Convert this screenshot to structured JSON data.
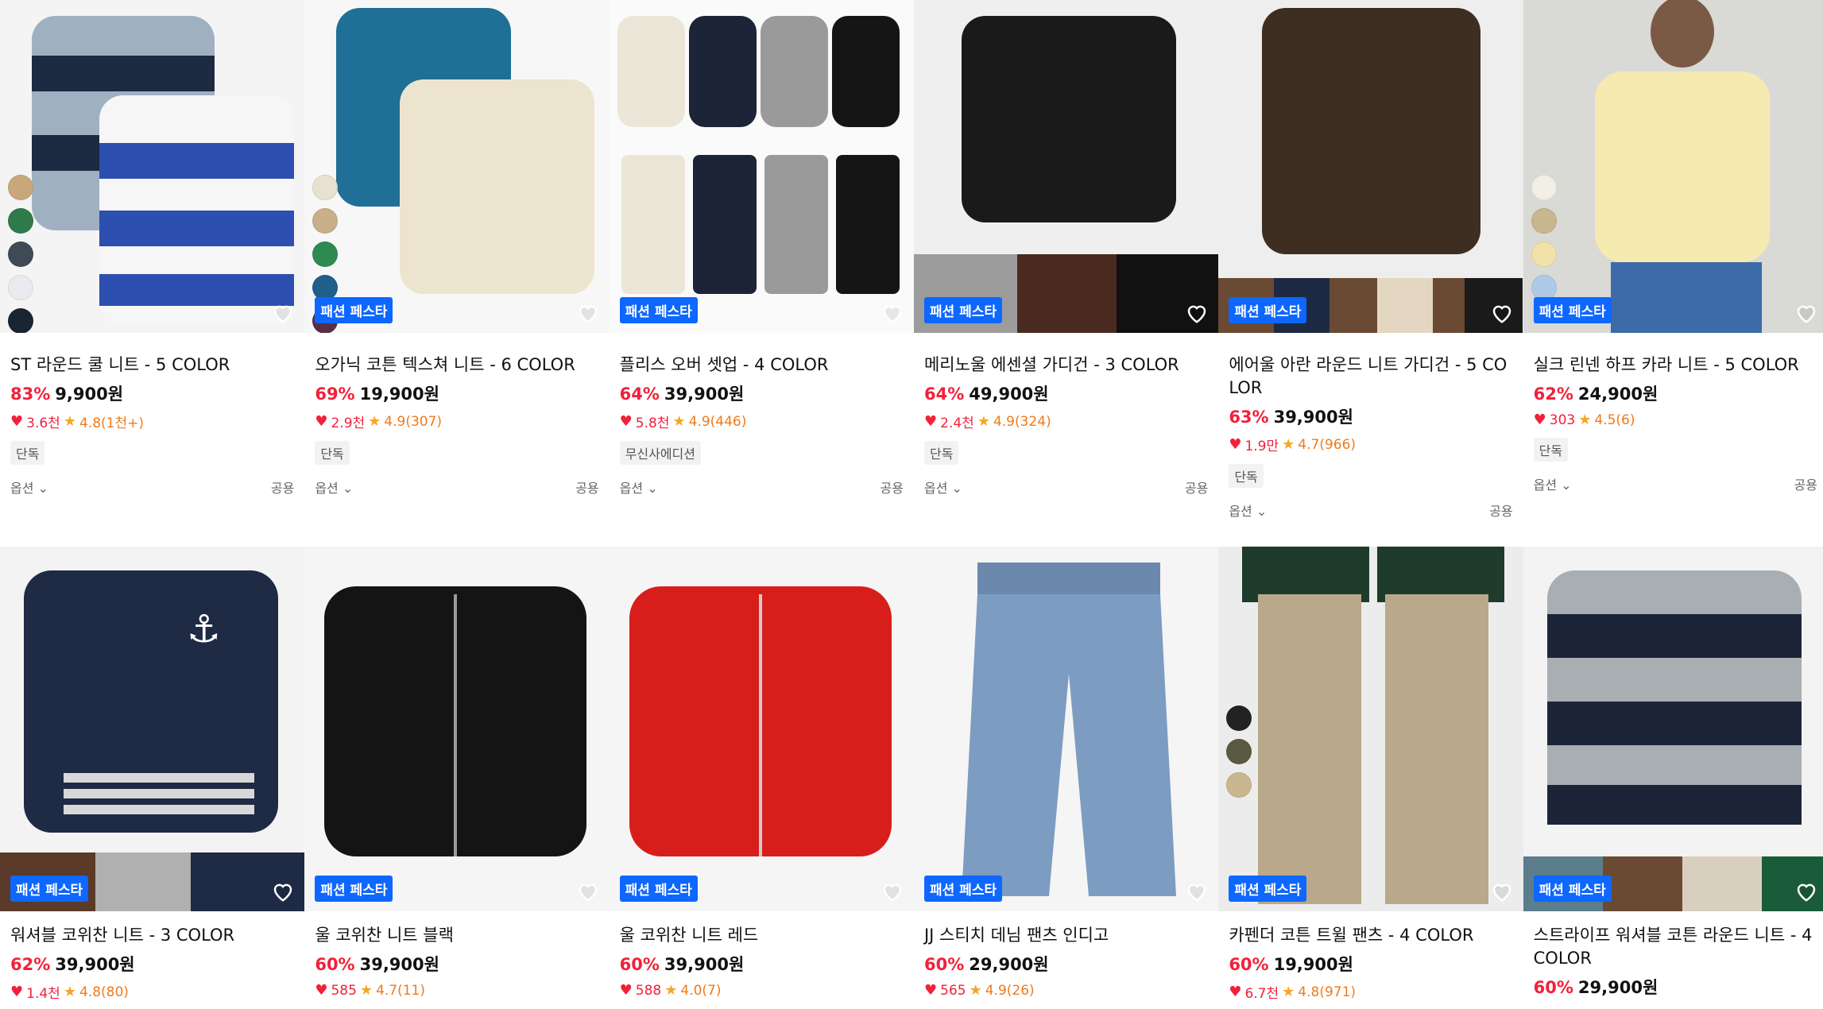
{
  "badge_label": "패션 페스타",
  "option_label": "옵션",
  "gender_label": "공용",
  "products": [
    {
      "title": "ST 라운드 쿨 니트 - 5 COLOR",
      "discount": "83%",
      "price": "9,900원",
      "likes": "3.6천",
      "rating": "4.8(1천+)",
      "tag": "단독",
      "festa": false,
      "swatches": [
        "#c9a77a",
        "#2f7a4a",
        "#3f4a55",
        "#eaeaf0",
        "#1a2533"
      ]
    },
    {
      "title": "오가닉 코튼 텍스쳐 니트 - 6 COLOR",
      "discount": "69%",
      "price": "19,900원",
      "likes": "2.9천",
      "rating": "4.9(307)",
      "tag": "단독",
      "festa": true,
      "swatches": [
        "#e9e1cf",
        "#c7b08a",
        "#2e8a50",
        "#1f5f8a",
        "#5a2f45"
      ]
    },
    {
      "title": "플리스 오버 셋업 - 4 COLOR",
      "discount": "64%",
      "price": "39,900원",
      "likes": "5.8천",
      "rating": "4.9(446)",
      "tag": "무신사에디션",
      "festa": true,
      "swatches": []
    },
    {
      "title": "메리노울 에센셜 가디건 - 3 COLOR",
      "discount": "64%",
      "price": "49,900원",
      "likes": "2.4천",
      "rating": "4.9(324)",
      "tag": "단독",
      "festa": true,
      "swatches": []
    },
    {
      "title": "에어울 아란 라운드 니트 가디건 - 5 COLOR",
      "discount": "63%",
      "price": "39,900원",
      "likes": "1.9만",
      "rating": "4.7(966)",
      "tag": "단독",
      "festa": true,
      "swatches": []
    },
    {
      "title": "실크 린넨 하프 카라 니트 - 5 COLOR",
      "discount": "62%",
      "price": "24,900원",
      "likes": "303",
      "rating": "4.5(6)",
      "tag": "단독",
      "festa": true,
      "swatches": [
        "#f2efe7",
        "#c8b68e",
        "#f0e2a8",
        "#aecae6"
      ]
    },
    {
      "title": "워셔블 코위찬 니트 - 3 COLOR",
      "discount": "62%",
      "price": "39,900원",
      "likes": "1.4천",
      "rating": "4.8(80)",
      "tag": "",
      "festa": true,
      "swatches": []
    },
    {
      "title": "울 코위찬 니트 블랙",
      "discount": "60%",
      "price": "39,900원",
      "likes": "585",
      "rating": "4.7(11)",
      "tag": "",
      "festa": true,
      "swatches": []
    },
    {
      "title": "울 코위찬 니트 레드",
      "discount": "60%",
      "price": "39,900원",
      "likes": "588",
      "rating": "4.0(7)",
      "tag": "",
      "festa": true,
      "swatches": []
    },
    {
      "title": "JJ 스티치 데님 팬츠 인디고",
      "discount": "60%",
      "price": "29,900원",
      "likes": "565",
      "rating": "4.9(26)",
      "tag": "",
      "festa": true,
      "swatches": []
    },
    {
      "title": "카펜더 코튼 트윌 팬츠 - 4 COLOR",
      "discount": "60%",
      "price": "19,900원",
      "likes": "6.7천",
      "rating": "4.8(971)",
      "tag": "",
      "festa": true,
      "swatches": [
        "#222",
        "#5a5a44",
        "#c9b78f"
      ]
    },
    {
      "title": "스트라이프 워셔블 코튼 라운드 니트 - 4 COLOR",
      "discount": "60%",
      "price": "29,900원",
      "likes": "",
      "rating": "",
      "tag": "",
      "festa": true,
      "swatches": []
    }
  ]
}
